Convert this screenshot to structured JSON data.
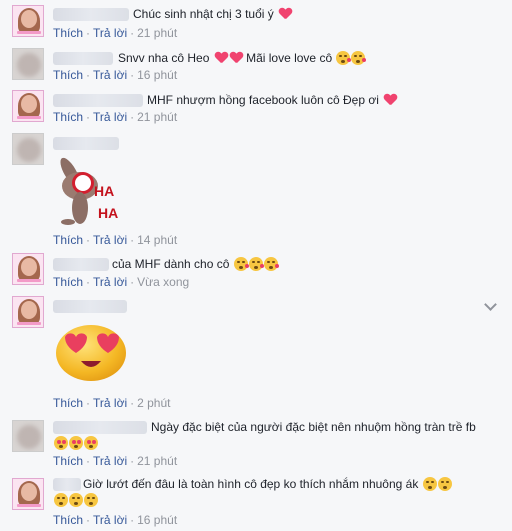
{
  "actions": {
    "like": "Thích",
    "reply": "Trả lời",
    "separator": "·"
  },
  "comments": [
    {
      "text": "Chúc sinh nhật chị 3 tuổi ý",
      "time": "21 phút"
    },
    {
      "text": "Snvv nha cô Heo",
      "text2": "Mãi love love cô",
      "time": "16 phút"
    },
    {
      "text": "MHF nhượm hồng facebook luôn cô Đẹp ơi",
      "time": "21 phút"
    },
    {
      "sticker_text": "HA HA",
      "time": "14 phút"
    },
    {
      "text": "của MHF dành cho cô",
      "time": "Vừa xong"
    },
    {
      "time": "2 phút"
    },
    {
      "text": "Ngày đặc biệt của người đặc biệt nên nhuộm hồng tràn trề fb",
      "time": "21 phút"
    },
    {
      "text": "Giờ lướt đến đâu là toàn hình cô đẹp ko thích nhắm nhuông ák",
      "time": "16 phút"
    }
  ],
  "icons": {
    "heart": "heart-icon",
    "kiss_emoji": "kissing-face-icon",
    "heart_eyes_emoji": "heart-eyes-face-icon",
    "chevron": "chevron-down-icon"
  },
  "colors": {
    "link": "#365899",
    "meta": "#90949c",
    "heart": "#f0436f"
  }
}
